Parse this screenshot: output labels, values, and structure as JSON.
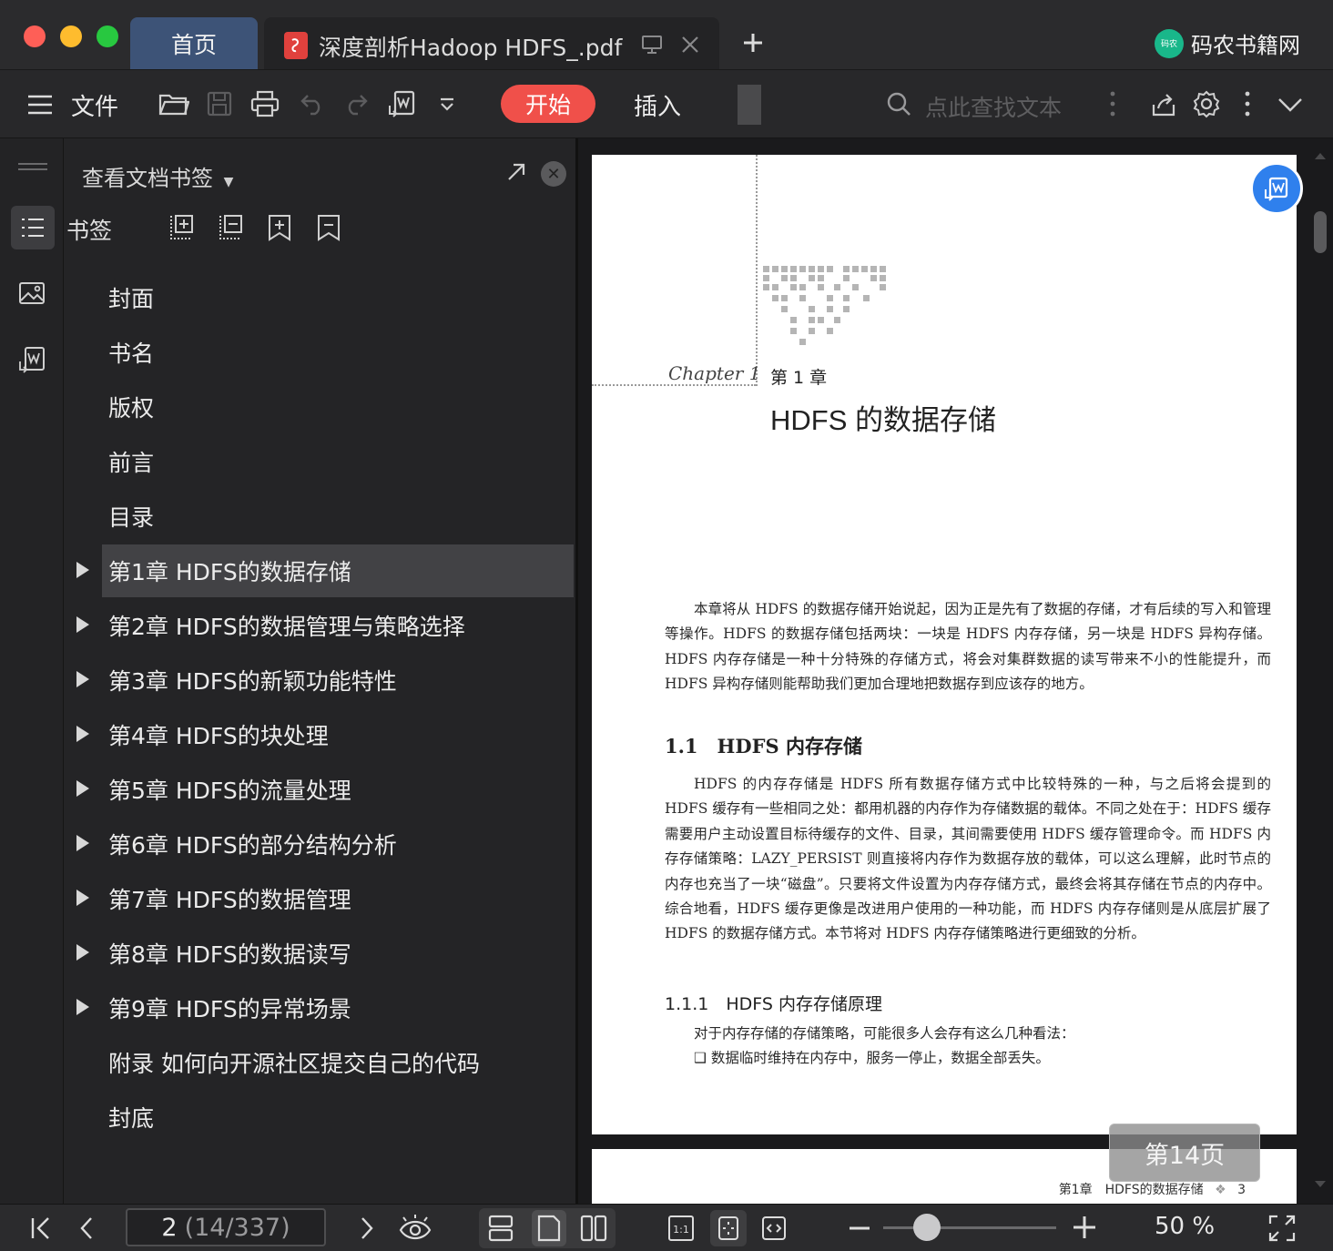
{
  "window": {
    "tabs": [
      {
        "label": "首页",
        "active": false
      },
      {
        "label": "深度剖析Hadoop HDFS_.pdf",
        "active": true
      }
    ],
    "brand": {
      "name": "码农书籍网",
      "logo_text": "码农"
    }
  },
  "toolbar": {
    "file_label": "文件",
    "start_label": "开始",
    "insert_label": "插入",
    "search_placeholder": "点此查找文本"
  },
  "sidebar": {
    "panel_title": "查看文档书签",
    "bookmark_label": "书签",
    "items": [
      {
        "label": "封面",
        "expandable": false,
        "selected": false
      },
      {
        "label": "书名",
        "expandable": false,
        "selected": false
      },
      {
        "label": "版权",
        "expandable": false,
        "selected": false
      },
      {
        "label": "前言",
        "expandable": false,
        "selected": false
      },
      {
        "label": "目录",
        "expandable": false,
        "selected": false
      },
      {
        "label": "第1章 HDFS的数据存储",
        "expandable": true,
        "selected": true
      },
      {
        "label": "第2章 HDFS的数据管理与策略选择",
        "expandable": true,
        "selected": false
      },
      {
        "label": "第3章 HDFS的新颖功能特性",
        "expandable": true,
        "selected": false
      },
      {
        "label": "第4章 HDFS的块处理",
        "expandable": true,
        "selected": false
      },
      {
        "label": "第5章 HDFS的流量处理",
        "expandable": true,
        "selected": false
      },
      {
        "label": "第6章 HDFS的部分结构分析",
        "expandable": true,
        "selected": false
      },
      {
        "label": "第7章 HDFS的数据管理",
        "expandable": true,
        "selected": false
      },
      {
        "label": "第8章 HDFS的数据读写",
        "expandable": true,
        "selected": false
      },
      {
        "label": "第9章 HDFS的异常场景",
        "expandable": true,
        "selected": false
      },
      {
        "label": "附录 如何向开源社区提交自己的代码",
        "expandable": false,
        "selected": false
      },
      {
        "label": "封底",
        "expandable": false,
        "selected": false
      }
    ]
  },
  "document": {
    "chapter_script": "Chapter 1",
    "chapter_num": "第 1 章",
    "chapter_title": "HDFS 的数据存储",
    "intro": "本章将从 HDFS 的数据存储开始说起，因为正是先有了数据的存储，才有后续的写入和管理等操作。HDFS 的数据存储包括两块：一块是 HDFS 内存存储，另一块是 HDFS 异构存储。HDFS 内存存储是一种十分特殊的存储方式，将会对集群数据的读写带来不小的性能提升，而 HDFS 异构存储则能帮助我们更加合理地把数据存到应该存的地方。",
    "section_1_1": "1.1　HDFS 内存存储",
    "section_1_1_body": "HDFS 的内存存储是 HDFS 所有数据存储方式中比较特殊的一种，与之后将会提到的 HDFS 缓存有一些相同之处：都用机器的内存作为存储数据的载体。不同之处在于：HDFS 缓存需要用户主动设置目标待缓存的文件、目录，其间需要使用 HDFS 缓存管理命令。而 HDFS 内存存储策略：LAZY_PERSIST 则直接将内存作为数据存放的载体，可以这么理解，此时节点的内存也充当了一块“磁盘”。只要将文件设置为内存存储方式，最终会将其存储在节点的内存中。综合地看，HDFS 缓存更像是改进用户使用的一种功能，而 HDFS 内存存储则是从底层扩展了 HDFS 的数据存储方式。本节将对 HDFS 内存存储策略进行更细致的分析。",
    "section_1_1_1": "1.1.1　HDFS 内存存储原理",
    "section_1_1_1_intro": "对于内存存储的存储策略，可能很多人会存有这么几种看法：",
    "bullet_1": "❑ 数据临时维持在内存中，服务一停止，数据全部丢失。",
    "page2_header_chapter": "第1章　HDFS的数据存储",
    "page2_header_num": "3",
    "page_badge": "第14页"
  },
  "statusbar": {
    "page_current": "2",
    "page_detail": "(14/337)",
    "zoom": "50 %",
    "zoom_level": 0.25
  },
  "colors": {
    "accent": "#f0504a",
    "tab_active_bg": "#3d5377",
    "float_button": "#2f80ed"
  }
}
